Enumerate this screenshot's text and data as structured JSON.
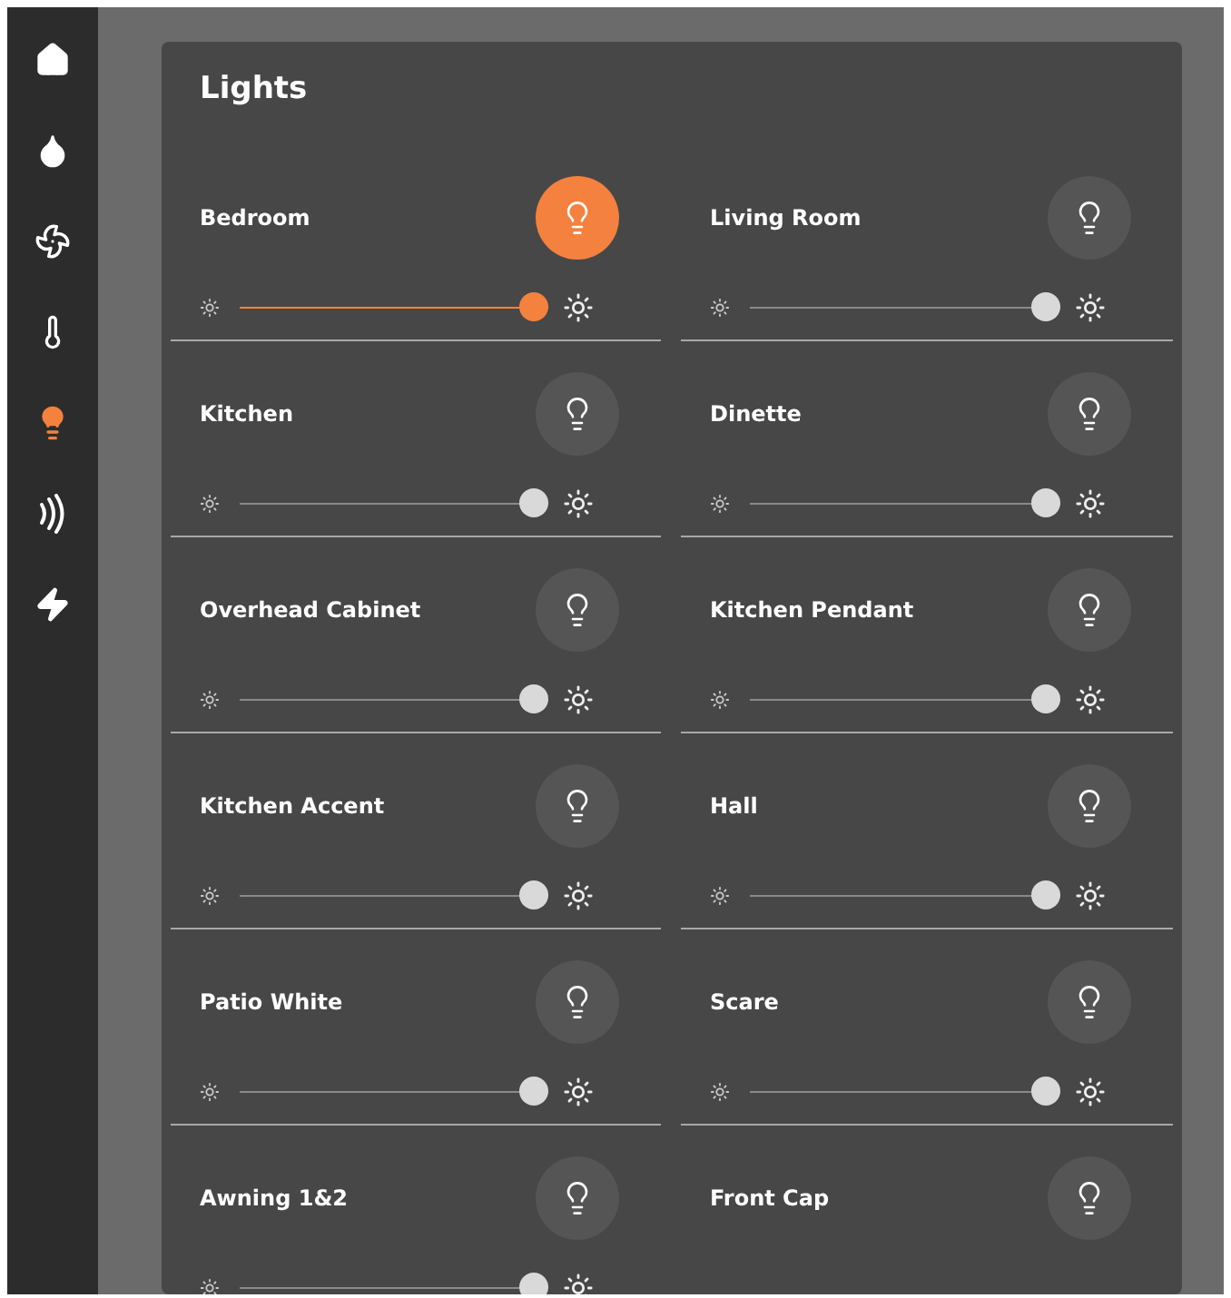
{
  "nav": [
    {
      "kind": "home",
      "selected": false
    },
    {
      "kind": "water",
      "selected": false
    },
    {
      "kind": "climate",
      "selected": false
    },
    {
      "kind": "temperature",
      "selected": false
    },
    {
      "kind": "lights",
      "selected": true
    },
    {
      "kind": "signal",
      "selected": false
    },
    {
      "kind": "power",
      "selected": false
    }
  ],
  "panel": {
    "title": "Lights"
  },
  "lights": [
    {
      "name": "Bedroom",
      "on": true,
      "level": 1
    },
    {
      "name": "Living Room",
      "on": false,
      "level": 1
    },
    {
      "name": "Kitchen",
      "on": false,
      "level": 1
    },
    {
      "name": "Dinette",
      "on": false,
      "level": 1
    },
    {
      "name": "Overhead Cabinet",
      "on": false,
      "level": 1
    },
    {
      "name": "Kitchen Pendant",
      "on": false,
      "level": 1
    },
    {
      "name": "Kitchen Accent",
      "on": false,
      "level": 1
    },
    {
      "name": "Hall",
      "on": false,
      "level": 1
    },
    {
      "name": "Patio White",
      "on": false,
      "level": 1
    },
    {
      "name": "Scare",
      "on": false,
      "level": 1
    },
    {
      "name": "Awning 1&2",
      "on": false,
      "level": 1
    },
    {
      "name": "Front Cap",
      "on": false
    }
  ]
}
